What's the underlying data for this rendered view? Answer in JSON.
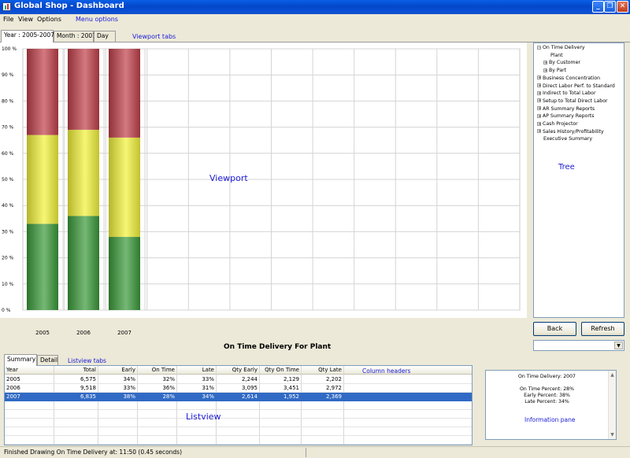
{
  "window": {
    "title": "Global Shop - Dashboard"
  },
  "menu": {
    "items": [
      "File",
      "View",
      "Options"
    ],
    "annotation": "Menu options"
  },
  "viewport_tabs": {
    "items": [
      "Year : 2005-2007",
      "Month : 2007",
      "Day"
    ],
    "active": 0,
    "annotation": "Viewport tabs"
  },
  "viewport_label": "Viewport",
  "chart_data": {
    "type": "bar",
    "stacked": true,
    "categories": [
      "2005",
      "2006",
      "2007"
    ],
    "series": [
      {
        "color": "#3a9a3a",
        "values": [
          33,
          36,
          28
        ]
      },
      {
        "color": "#f2f23a",
        "values": [
          34,
          33,
          38
        ]
      },
      {
        "color": "#c0404a",
        "values": [
          33,
          31,
          34
        ]
      }
    ],
    "ylim": [
      0,
      100
    ],
    "yticks": [
      "0 %",
      "10 %",
      "20 %",
      "30 %",
      "40 %",
      "50 %",
      "60 %",
      "70 %",
      "80 %",
      "90 %",
      "100 %"
    ],
    "grid": true,
    "title": "On Time Delivery For Plant"
  },
  "tree": {
    "annotation": "Tree",
    "nodes": [
      {
        "label": "On Time Delivery",
        "level": 0,
        "expander": "minus"
      },
      {
        "label": "Plant",
        "level": 1,
        "expander": "none"
      },
      {
        "label": "By Customer",
        "level": 1,
        "expander": "plus"
      },
      {
        "label": "By Part",
        "level": 1,
        "expander": "plus"
      },
      {
        "label": "Business Concentration",
        "level": 0,
        "expander": "plus"
      },
      {
        "label": "Direct Labor Perf. to Standard",
        "level": 0,
        "expander": "plus"
      },
      {
        "label": "Indirect to Total Labor",
        "level": 0,
        "expander": "plus"
      },
      {
        "label": "Setup to Total Direct Labor",
        "level": 0,
        "expander": "plus"
      },
      {
        "label": "AR Summary Reports",
        "level": 0,
        "expander": "plus"
      },
      {
        "label": "AP Summary Reports",
        "level": 0,
        "expander": "plus"
      },
      {
        "label": "Cash Projector",
        "level": 0,
        "expander": "plus"
      },
      {
        "label": "Sales History/Profitability",
        "level": 0,
        "expander": "plus"
      },
      {
        "label": "Executive Summary",
        "level": 0,
        "expander": "none"
      }
    ]
  },
  "buttons": {
    "back": "Back",
    "refresh": "Refresh"
  },
  "listview_tabs": {
    "items": [
      "Summary",
      "Detail"
    ],
    "active": 0,
    "annotation": "Listview tabs"
  },
  "listview": {
    "annotation": "Listview",
    "columns_annotation": "Column headers",
    "columns": [
      "Year",
      "Total",
      "Early",
      "On Time",
      "Late",
      "Qty Early",
      "Qty On Time",
      "Qty Late"
    ],
    "rows": [
      [
        "2005",
        "6,575",
        "34%",
        "32%",
        "33%",
        "2,244",
        "2,129",
        "2,202"
      ],
      [
        "2006",
        "9,518",
        "33%",
        "36%",
        "31%",
        "3,095",
        "3,451",
        "2,972"
      ],
      [
        "2007",
        "6,835",
        "38%",
        "28%",
        "34%",
        "2,614",
        "1,952",
        "2,369"
      ]
    ],
    "selected_row": 2
  },
  "info_pane": {
    "annotation": "Information pane",
    "heading": "On Time Delivery: 2007",
    "lines": [
      "On Time Percent: 28%",
      "Early Percent: 38%",
      "Late Percent: 34%"
    ]
  },
  "status": {
    "text": "Finished Drawing On Time Delivery at: 11:50 (0.45 seconds)"
  }
}
